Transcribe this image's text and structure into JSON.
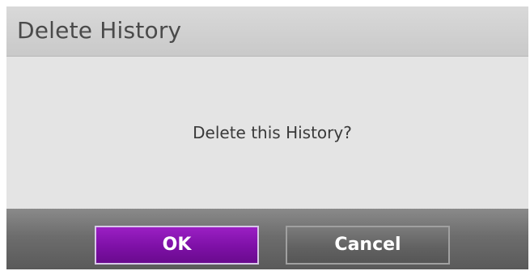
{
  "dialog": {
    "title": "Delete History",
    "message": "Delete this History?",
    "buttons": {
      "ok_label": "OK",
      "cancel_label": "Cancel"
    }
  },
  "colors": {
    "ok_button": "#7d10a6",
    "cancel_button": "#626262",
    "title_bar": "#d1d1d1",
    "body": "#e4e4e4"
  }
}
